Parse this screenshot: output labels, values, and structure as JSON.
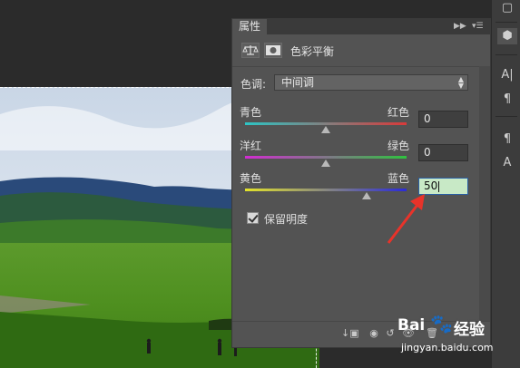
{
  "panel": {
    "tab_label": "属性",
    "header_title": "色彩平衡",
    "header_icons": [
      "scales-icon",
      "layer-mask-icon"
    ]
  },
  "tone": {
    "label": "色调:",
    "value": "中间调"
  },
  "sliders": [
    {
      "left_label": "青色",
      "right_label": "红色",
      "value": "0",
      "level": 0,
      "gradient": [
        "#2dc4c4",
        "#d83a3a"
      ]
    },
    {
      "left_label": "洋红",
      "right_label": "绿色",
      "value": "0",
      "level": 0,
      "gradient": [
        "#d22cd2",
        "#2fc23f"
      ]
    },
    {
      "left_label": "黄色",
      "right_label": "蓝色",
      "value": "50",
      "level": 50,
      "gradient": [
        "#e3e32a",
        "#2b2bd8"
      ]
    }
  ],
  "preserve_luminosity": {
    "label": "保留明度",
    "checked": true
  },
  "watermark": {
    "brand": "Bai",
    "brand_suffix": "经验",
    "url": "jingyan.baidu.com"
  },
  "colors": {
    "panel_bg": "#535353",
    "active_field": "#c8e9c6",
    "annotation_arrow": "#e8332a"
  }
}
